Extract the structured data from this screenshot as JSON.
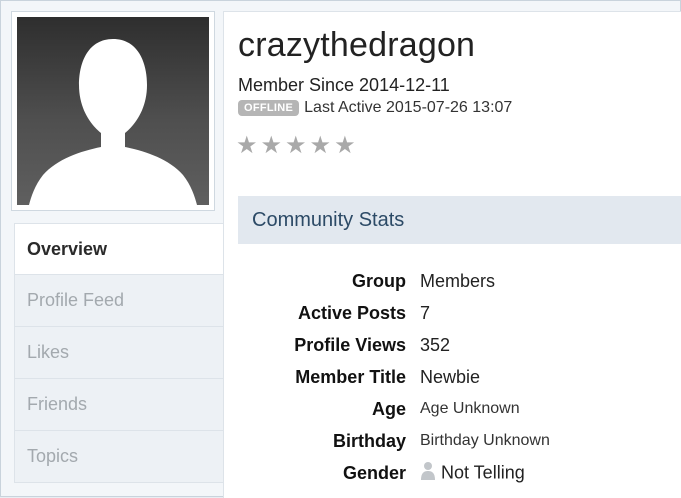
{
  "profile": {
    "username": "crazythedragon",
    "member_since": "Member Since 2014-12-11",
    "status_badge": "OFFLINE",
    "last_active": "Last Active 2015-07-26 13:07",
    "rating_stars": 0,
    "rating_max": 5
  },
  "sidebar": {
    "items": [
      {
        "label": "Overview",
        "active": true
      },
      {
        "label": "Profile Feed",
        "active": false
      },
      {
        "label": "Likes",
        "active": false
      },
      {
        "label": "Friends",
        "active": false
      },
      {
        "label": "Topics",
        "active": false
      }
    ]
  },
  "stats": {
    "title": "Community Stats",
    "rows": [
      {
        "label": "Group",
        "value": "Members"
      },
      {
        "label": "Active Posts",
        "value": "7"
      },
      {
        "label": "Profile Views",
        "value": "352"
      },
      {
        "label": "Member Title",
        "value": "Newbie"
      },
      {
        "label": "Age",
        "value": "Age Unknown"
      },
      {
        "label": "Birthday",
        "value": "Birthday Unknown"
      },
      {
        "label": "Gender",
        "value": "Not Telling",
        "icon": "person-icon"
      }
    ]
  },
  "colors": {
    "header_bg": "#e2e8ef",
    "header_text": "#2c4a66",
    "badge_offline": "#b5b5b5",
    "star_empty": "#a9a9a9"
  }
}
